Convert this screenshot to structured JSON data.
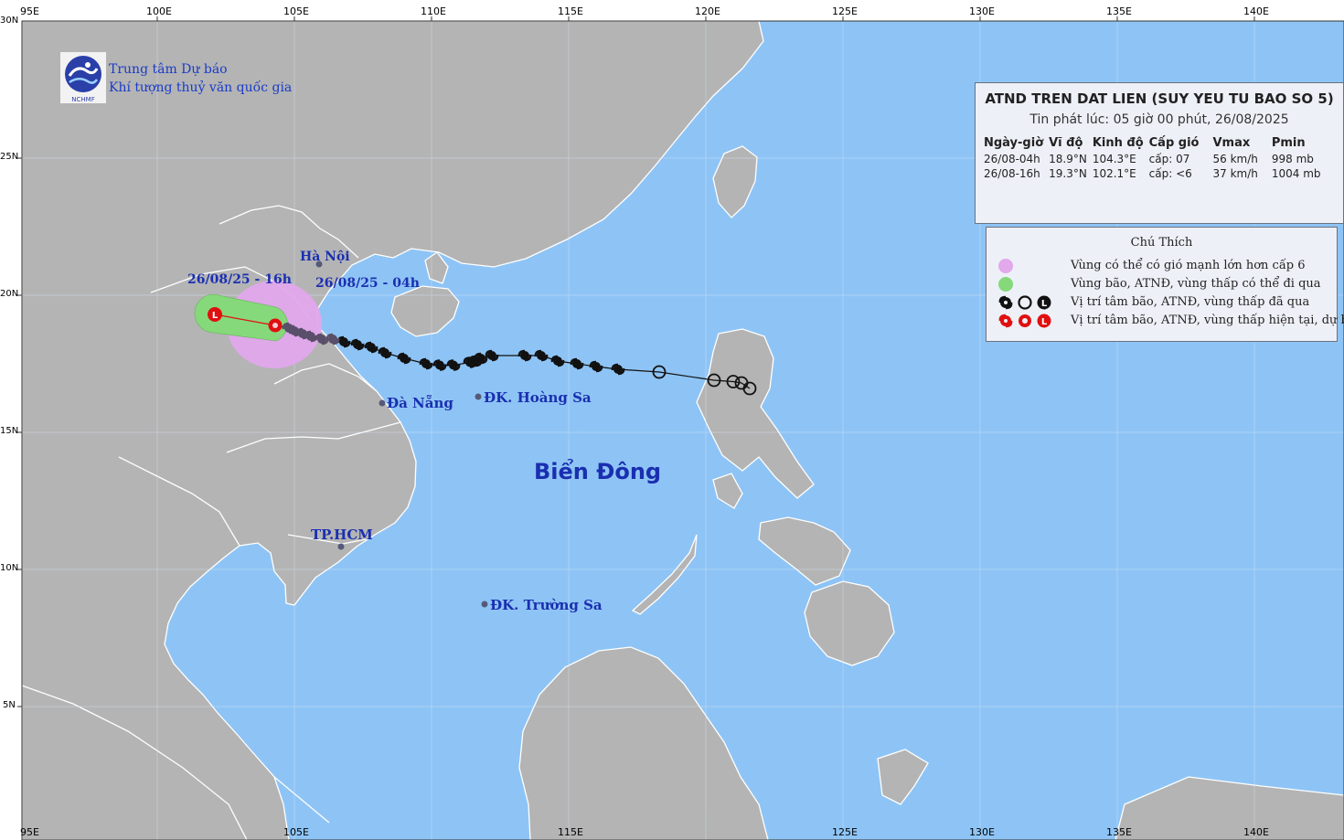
{
  "organization": {
    "line1": "Trung tâm Dự báo",
    "line2": "Khí tượng thuỷ văn quốc gia",
    "logo_text": "NCHMF"
  },
  "bulletin": {
    "title": "ATND TREN DAT LIEN (SUY YEU TU BAO SO 5)",
    "issued": "Tin phát lúc: 05 giờ 00 phút, 26/08/2025",
    "columns": [
      "Ngày-giờ",
      "Vĩ độ",
      "Kinh độ",
      "Cấp gió",
      "Vmax",
      "Pmin"
    ],
    "rows": [
      [
        "26/08-04h",
        "18.9°N",
        "104.3°E",
        "cấp: 07",
        "56 km/h",
        "998 mb"
      ],
      [
        "26/08-16h",
        "19.3°N",
        "102.1°E",
        "cấp: <6",
        "37 km/h",
        "1004 mb"
      ]
    ]
  },
  "legend": {
    "title": "Chú Thích",
    "items": [
      {
        "symbol": "purple-circle-icon",
        "text": "Vùng có thể có gió mạnh lớn hơn cấp 6"
      },
      {
        "symbol": "green-circle-icon",
        "text": "Vùng bão, ATNĐ, vùng thấp có thể đi qua"
      },
      {
        "symbol": "black-storm-symbols-icon",
        "text": "Vị trí tâm bão, ATNĐ, vùng thấp đã qua"
      },
      {
        "symbol": "red-storm-symbols-icon",
        "text": "Vị trí tâm bão, ATNĐ, vùng thấp hiện tại, dự báo"
      }
    ]
  },
  "map_labels": {
    "hanoi": "Hà Nội",
    "danang": "Đà Nẵng",
    "hoangsa": "ĐK. Hoàng Sa",
    "hcm": "TP.HCM",
    "truongsa": "ĐK. Trường Sa",
    "sea": "Biển Đông",
    "forecast_16h": "26/08/25 - 16h",
    "current_04h": "26/08/25 - 04h"
  },
  "axes": {
    "lon_ticks_top": [
      "95E",
      "100E",
      "105E",
      "110E",
      "115E",
      "120E",
      "125E",
      "130E",
      "135E",
      "140E"
    ],
    "lon_ticks_bottom": [
      "95E",
      "105E",
      "115E",
      "125E",
      "130E",
      "135E",
      "140E"
    ],
    "lat_ticks": [
      "30N",
      "25N",
      "20N",
      "15N",
      "10N",
      "5N"
    ]
  },
  "colors": {
    "sea": "#8ec4f5",
    "land": "#b4b4b4",
    "border": "#ffffff",
    "wind_zone": "#e2a8ec",
    "cone": "#86d97a",
    "track_past": "#111111",
    "track_current": "#e01010",
    "label": "#1a2fb0"
  },
  "chart_data": {
    "type": "scatter",
    "title": "ATND TREN DAT LIEN (SUY YEU TU BAO SO 5)",
    "x_units": "longitude °E",
    "y_units": "latitude °N",
    "xlim": [
      95,
      143
    ],
    "ylim": [
      0,
      30
    ],
    "past_track": [
      [
        121.6,
        16.6
      ],
      [
        121.3,
        16.8
      ],
      [
        121.0,
        16.85
      ],
      [
        120.3,
        16.9
      ],
      [
        118.3,
        17.2
      ],
      [
        116.8,
        17.3
      ],
      [
        116.0,
        17.4
      ],
      [
        115.3,
        17.5
      ],
      [
        114.6,
        17.6
      ],
      [
        114.0,
        17.8
      ],
      [
        113.4,
        17.8
      ],
      [
        112.2,
        17.8
      ],
      [
        111.8,
        17.7
      ],
      [
        111.6,
        17.6
      ],
      [
        111.4,
        17.55
      ],
      [
        110.8,
        17.45
      ],
      [
        110.3,
        17.45
      ],
      [
        109.8,
        17.5
      ],
      [
        109.0,
        17.7
      ],
      [
        108.3,
        17.9
      ],
      [
        107.8,
        18.1
      ],
      [
        107.3,
        18.2
      ],
      [
        106.8,
        18.3
      ],
      [
        106.4,
        18.4
      ],
      [
        106.0,
        18.4
      ],
      [
        105.6,
        18.5
      ],
      [
        105.3,
        18.6
      ],
      [
        105.0,
        18.7
      ],
      [
        104.8,
        18.8
      ]
    ],
    "current": {
      "lon": 104.3,
      "lat": 18.9,
      "time": "26/08-04h"
    },
    "forecast": [
      {
        "lon": 102.1,
        "lat": 19.3,
        "time": "26/08-16h"
      }
    ]
  }
}
